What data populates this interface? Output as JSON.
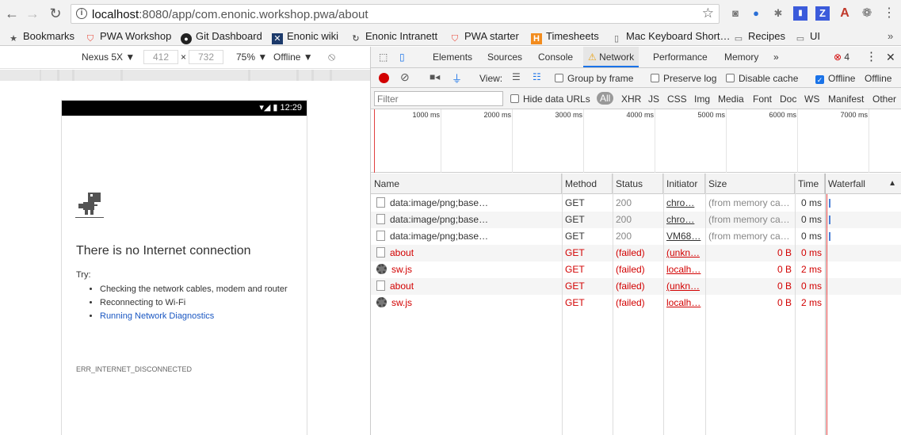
{
  "browser": {
    "url_host": "localhost",
    "url_rest": ":8080/app/com.enonic.workshop.pwa/about",
    "bookmarks": [
      {
        "label": "Bookmarks",
        "icon": "star-icon"
      },
      {
        "label": "PWA Workshop",
        "icon": "shield-icon"
      },
      {
        "label": "Git Dashboard",
        "icon": "github-icon"
      },
      {
        "label": "Enonic wiki",
        "icon": "enonic-icon"
      },
      {
        "label": "Enonic Intranett",
        "icon": "refresh-icon"
      },
      {
        "label": "PWA starter",
        "icon": "shield-icon"
      },
      {
        "label": "Timesheets",
        "icon": "harvest-icon"
      },
      {
        "label": "Mac Keyboard Short…",
        "icon": "document-icon"
      },
      {
        "label": "Recipes",
        "icon": "folder-icon"
      },
      {
        "label": "UI",
        "icon": "folder-icon"
      }
    ]
  },
  "device_toolbar": {
    "device": "Nexus 5X ▼",
    "width": "412",
    "height": "732",
    "times": "×",
    "zoom": "75% ▼",
    "throttle": "Offline ▼"
  },
  "phone": {
    "time": "12:29",
    "heading": "There is no Internet connection",
    "try_label": "Try:",
    "suggestions": [
      "Checking the network cables, modem and router",
      "Reconnecting to Wi-Fi",
      "Running Network Diagnostics"
    ],
    "error_code": "ERR_INTERNET_DISCONNECTED"
  },
  "devtools": {
    "tabs": [
      "Elements",
      "Sources",
      "Console",
      "Network",
      "Performance",
      "Memory",
      "»"
    ],
    "error_count": "4",
    "toolbar": {
      "view_label": "View:",
      "group_by_frame": "Group by frame",
      "preserve_log": "Preserve log",
      "disable_cache": "Disable cache",
      "offline": "Offline",
      "throttle": "Offline"
    },
    "filter": {
      "placeholder": "Filter",
      "hide_data_urls": "Hide data URLs",
      "types": [
        "All",
        "XHR",
        "JS",
        "CSS",
        "Img",
        "Media",
        "Font",
        "Doc",
        "WS",
        "Manifest",
        "Other"
      ]
    },
    "timeline_ticks": [
      "1000 ms",
      "2000 ms",
      "3000 ms",
      "4000 ms",
      "5000 ms",
      "6000 ms",
      "7000 ms"
    ],
    "columns": [
      "Name",
      "Method",
      "Status",
      "Initiator",
      "Size",
      "Time",
      "Waterfall"
    ],
    "rows": [
      {
        "name": "data:image/png;base…",
        "method": "GET",
        "status": "200",
        "initiator": "chro…",
        "size": "(from memory ca…",
        "time": "0 ms",
        "failed": false,
        "icon": "file"
      },
      {
        "name": "data:image/png;base…",
        "method": "GET",
        "status": "200",
        "initiator": "chro…",
        "size": "(from memory ca…",
        "time": "0 ms",
        "failed": false,
        "icon": "file"
      },
      {
        "name": "data:image/png;base…",
        "method": "GET",
        "status": "200",
        "initiator": "VM68…",
        "size": "(from memory ca…",
        "time": "0 ms",
        "failed": false,
        "icon": "file"
      },
      {
        "name": "about",
        "method": "GET",
        "status": "(failed)",
        "initiator": "(unkn…",
        "size": "0 B",
        "time": "0 ms",
        "failed": true,
        "icon": "file"
      },
      {
        "name": "sw.js",
        "method": "GET",
        "status": "(failed)",
        "initiator": "localh…",
        "size": "0 B",
        "time": "2 ms",
        "failed": true,
        "icon": "gear"
      },
      {
        "name": "about",
        "method": "GET",
        "status": "(failed)",
        "initiator": "(unkn…",
        "size": "0 B",
        "time": "0 ms",
        "failed": true,
        "icon": "file"
      },
      {
        "name": "sw.js",
        "method": "GET",
        "status": "(failed)",
        "initiator": "localh…",
        "size": "0 B",
        "time": "2 ms",
        "failed": true,
        "icon": "gear"
      }
    ]
  }
}
